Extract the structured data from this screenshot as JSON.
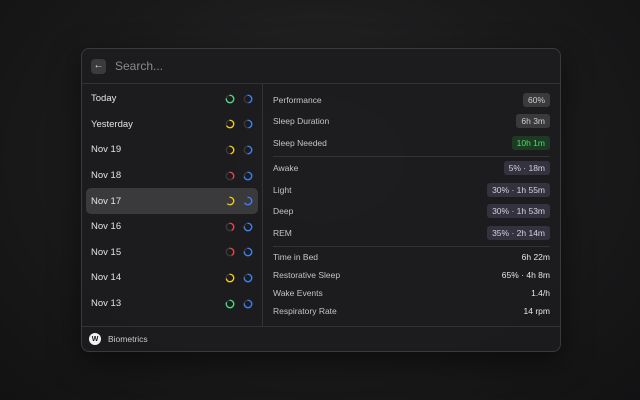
{
  "search": {
    "placeholder": "Search..."
  },
  "back_icon": "arrow-left-icon",
  "days": [
    {
      "label": "Today",
      "perf_color": "#4ade80",
      "perf": 0.75,
      "sleep_color": "#3b82f6",
      "sleep": 0.45
    },
    {
      "label": "Yesterday",
      "perf_color": "#facc15",
      "perf": 0.65,
      "sleep_color": "#3b82f6",
      "sleep": 0.45
    },
    {
      "label": "Nov 19",
      "perf_color": "#facc15",
      "perf": 0.45,
      "sleep_color": "#3b82f6",
      "sleep": 0.5
    },
    {
      "label": "Nov 18",
      "perf_color": "#ef4444",
      "perf": 0.35,
      "sleep_color": "#3b82f6",
      "sleep": 0.7
    },
    {
      "label": "Nov 17",
      "perf_color": "#facc15",
      "perf": 0.6,
      "sleep_color": "#3b82f6",
      "sleep": 0.65,
      "selected": true
    },
    {
      "label": "Nov 16",
      "perf_color": "#ef4444",
      "perf": 0.4,
      "sleep_color": "#3b82f6",
      "sleep": 0.75
    },
    {
      "label": "Nov 15",
      "perf_color": "#ef4444",
      "perf": 0.4,
      "sleep_color": "#3b82f6",
      "sleep": 0.75
    },
    {
      "label": "Nov 14",
      "perf_color": "#facc15",
      "perf": 0.7,
      "sleep_color": "#3b82f6",
      "sleep": 0.75
    },
    {
      "label": "Nov 13",
      "perf_color": "#4ade80",
      "perf": 0.8,
      "sleep_color": "#3b82f6",
      "sleep": 0.75
    }
  ],
  "detail": {
    "performance": {
      "label": "Performance",
      "value": "60%"
    },
    "sleep_duration": {
      "label": "Sleep Duration",
      "value": "6h 3m"
    },
    "sleep_needed": {
      "label": "Sleep Needed",
      "value": "10h 1m"
    },
    "awake": {
      "label": "Awake",
      "value": "5%  ·  18m"
    },
    "light": {
      "label": "Light",
      "value": "30%  ·  1h 55m"
    },
    "deep": {
      "label": "Deep",
      "value": "30%  ·  1h 53m"
    },
    "rem": {
      "label": "REM",
      "value": "35%  ·  2h 14m"
    },
    "time_in_bed": {
      "label": "Time in Bed",
      "value": "6h 22m"
    },
    "restorative": {
      "label": "Restorative Sleep",
      "value": "65%  ·  4h 8m"
    },
    "wake_events": {
      "label": "Wake Events",
      "value": "1.4/h"
    },
    "resp_rate": {
      "label": "Respiratory Rate",
      "value": "14 rpm"
    }
  },
  "footer": {
    "logo_text": "W",
    "title": "Biometrics"
  }
}
